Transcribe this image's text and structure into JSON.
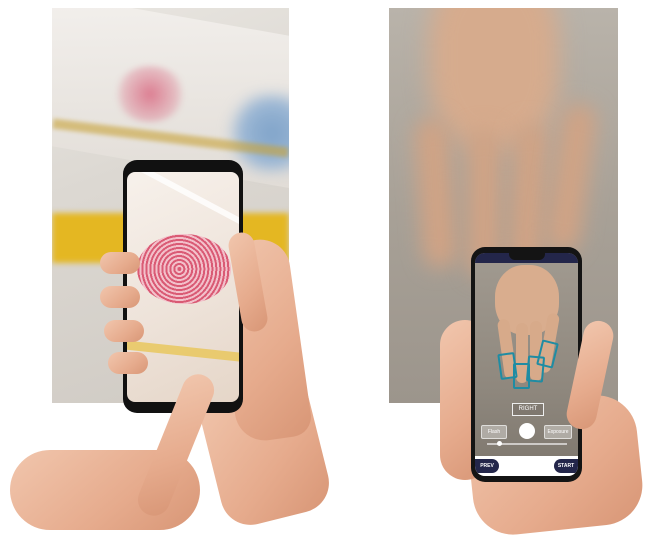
{
  "left_scene": {
    "description_hidden": ""
  },
  "right_app": {
    "status_left": "",
    "status_right": "",
    "hand_label": "RIGHT",
    "flash_label": "Flash",
    "exposure_label": "Exposure",
    "prev_label": "PREV",
    "start_label": "START",
    "accent_color": "#1f8ca3",
    "nav_color": "#23264a"
  }
}
